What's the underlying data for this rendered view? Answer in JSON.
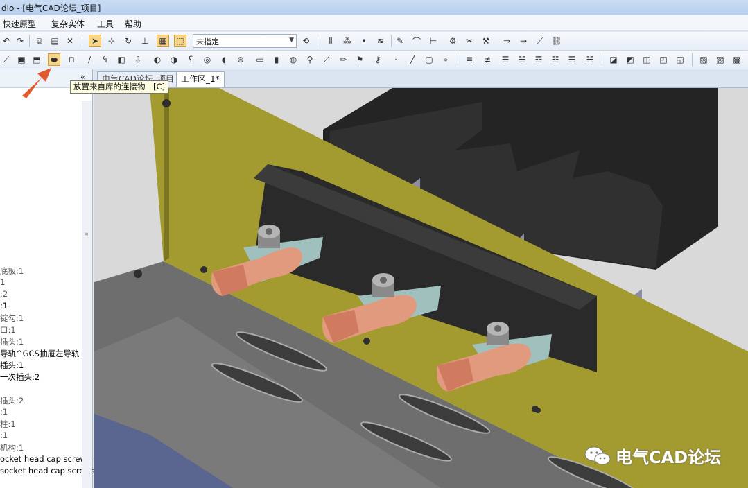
{
  "title": "dio - [电气CAD论坛_项目]",
  "menu": [
    "快速原型",
    "复杂实体",
    "工具",
    "帮助"
  ],
  "toolbar": {
    "view_combo_value": "未指定"
  },
  "tooltip": "放置来自库的连接物　[C]",
  "tabs": [
    {
      "label": "电气CAD论坛_项目"
    },
    {
      "label": "工作区_1*"
    }
  ],
  "left_tree": [
    {
      "text": "底板:1",
      "bold": false
    },
    {
      "text": "1",
      "bold": false
    },
    {
      "text": ":2",
      "bold": false
    },
    {
      "text": ":1",
      "bold": true
    },
    {
      "text": "锭勾:1",
      "bold": false
    },
    {
      "text": "口:1",
      "bold": false
    },
    {
      "text": "插头:1",
      "bold": false
    },
    {
      "text": "导轨^GCS抽屉左导轨",
      "bold": true
    },
    {
      "text": "插头:1",
      "bold": true
    },
    {
      "text": "一次插头:2",
      "bold": true
    },
    {
      "text": "插头:2",
      "bold": false
    },
    {
      "text": ":1",
      "bold": false
    },
    {
      "text": "柱:1",
      "bold": false
    },
    {
      "text": ":1",
      "bold": false
    },
    {
      "text": "机构:1",
      "bold": false
    },
    {
      "text": "ocket head cap screws GB",
      "bold": true
    },
    {
      "text": "socket head cap screws",
      "bold": true
    }
  ],
  "watermark": "电气CAD论坛",
  "colors": {
    "panel": "#a9a032",
    "plate": "#6f6f6f",
    "block": "#2b2b2b",
    "lug": "#e29a7f",
    "arrow": "#e0582e"
  }
}
